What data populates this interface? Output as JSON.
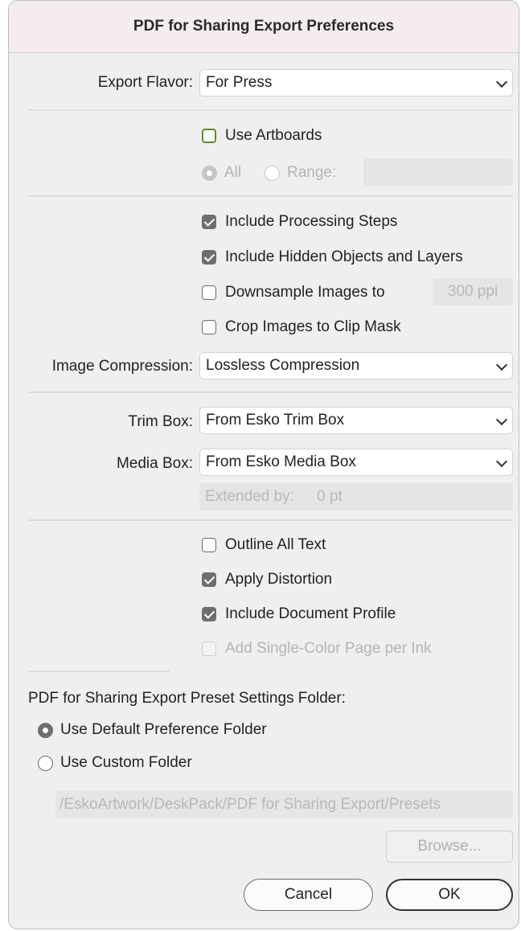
{
  "dialog": {
    "title": "PDF for Sharing Export Preferences"
  },
  "export_flavor": {
    "label": "Export Flavor:",
    "value": "For Press"
  },
  "artboards": {
    "use_label": "Use Artboards",
    "all_label": "All",
    "range_label": "Range:",
    "range_value": ""
  },
  "options": {
    "include_processing_steps": "Include Processing Steps",
    "include_hidden": "Include Hidden Objects and Layers",
    "downsample": "Downsample Images to",
    "downsample_value": "300 ppi",
    "crop_images": "Crop Images to Clip Mask"
  },
  "image_compression": {
    "label": "Image Compression:",
    "value": "Lossless Compression"
  },
  "trim_box": {
    "label": "Trim Box:",
    "value": "From Esko Trim Box"
  },
  "media_box": {
    "label": "Media Box:",
    "value": "From Esko Media Box"
  },
  "extended_by": {
    "label": "Extended by:",
    "value": "0 pt"
  },
  "text_options": {
    "outline_all_text": "Outline All Text",
    "apply_distortion": "Apply Distortion",
    "include_document_profile": "Include Document Profile",
    "add_single_color_page": "Add Single-Color Page per Ink"
  },
  "preset_folder": {
    "heading": "PDF for Sharing Export Preset Settings Folder:",
    "use_default": "Use Default Preference Folder",
    "use_custom": "Use Custom Folder",
    "path": "/EskoArtwork/DeskPack/PDF for Sharing Export/Presets",
    "browse": "Browse..."
  },
  "buttons": {
    "cancel": "Cancel",
    "ok": "OK"
  },
  "colors": {
    "title_bar": "#f4ecf1",
    "checkbox_checked": "#6e6e6e",
    "artboards_border": "#5f8a2e"
  }
}
